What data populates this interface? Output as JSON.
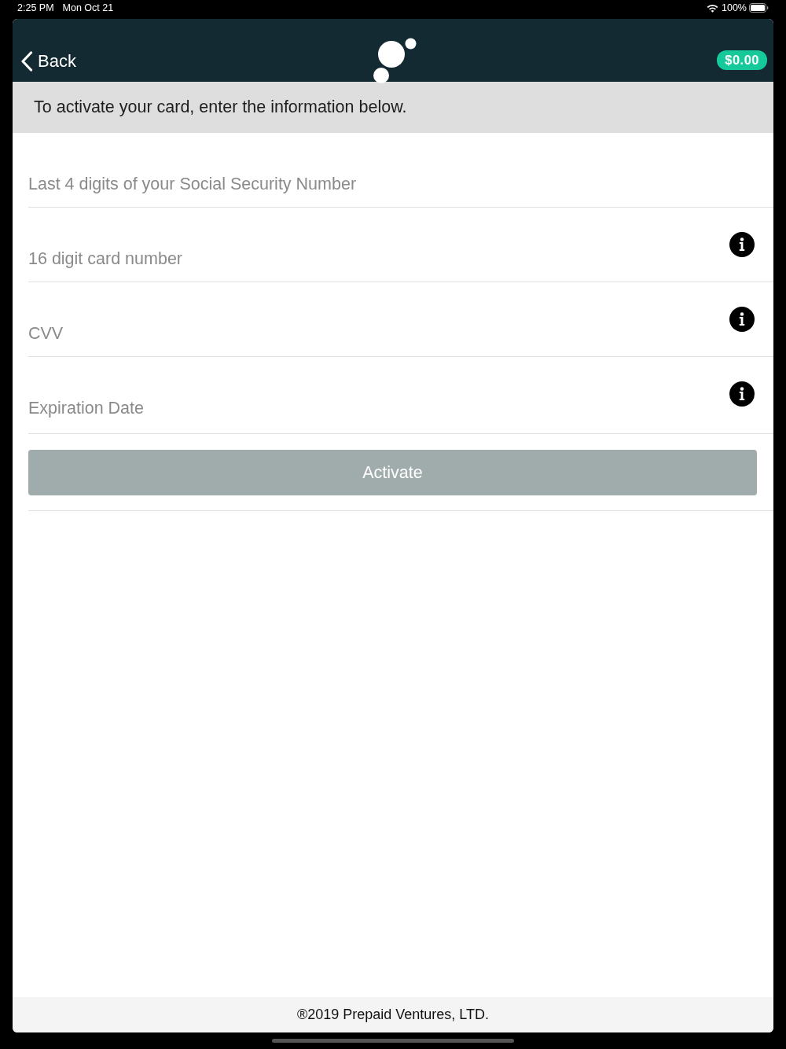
{
  "status_bar": {
    "time": "2:25 PM",
    "date": "Mon Oct 21",
    "battery": "100%"
  },
  "header": {
    "back": "Back",
    "balance": "$0.00"
  },
  "instructions": "To activate your card, enter the information below.",
  "fields": [
    {
      "placeholder": "Last 4 digits of your Social Security Number",
      "info": false
    },
    {
      "placeholder": "16 digit card number",
      "info": true
    },
    {
      "placeholder": "CVV",
      "info": true
    },
    {
      "placeholder": "Expiration Date",
      "info": true
    }
  ],
  "activate_button": {
    "label": "Activate",
    "disabled": true
  },
  "footer": "®2019 Prepaid Ventures, LTD."
}
